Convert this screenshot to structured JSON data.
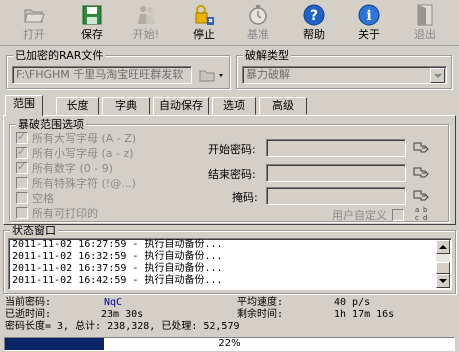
{
  "toolbar": {
    "buttons": [
      {
        "label": "打开",
        "icon": "open-folder-icon",
        "enabled": false
      },
      {
        "label": "保存",
        "icon": "save-disk-icon",
        "enabled": true
      },
      {
        "label": "开始!",
        "icon": "start-people-icon",
        "enabled": false
      },
      {
        "label": "停止",
        "icon": "stop-lock-icon",
        "enabled": true
      },
      {
        "label": "基准",
        "icon": "stopwatch-icon",
        "enabled": false
      },
      {
        "label": "帮助",
        "icon": "help-icon",
        "enabled": true
      },
      {
        "label": "关于",
        "icon": "info-icon",
        "enabled": true
      },
      {
        "label": "退出",
        "icon": "exit-door-icon",
        "enabled": false
      }
    ]
  },
  "file_group": {
    "title": "已加密的RAR文件",
    "path": "F:\\FHGHM 千里马淘宝旺旺群发软"
  },
  "crack_type": {
    "title": "破解类型",
    "selected": "暴力破解"
  },
  "tabs": [
    {
      "label": "范围",
      "active": true
    },
    {
      "label": "长度",
      "active": false
    },
    {
      "label": "字典",
      "active": false
    },
    {
      "label": "自动保存",
      "active": false
    },
    {
      "label": "选项",
      "active": false
    },
    {
      "label": "高级",
      "active": false
    }
  ],
  "range_options": {
    "title": "暴破范围选项",
    "checkboxes": [
      {
        "label": "所有大写字母 (A - Z)",
        "checked": true
      },
      {
        "label": "所有小写字母 (a - z)",
        "checked": true
      },
      {
        "label": "所有数字 (0 - 9)",
        "checked": true
      },
      {
        "label": "所有特殊字符 (!@...)",
        "checked": false
      },
      {
        "label": "空格",
        "checked": false
      },
      {
        "label": "所有可打印的",
        "checked": false
      }
    ],
    "start_password_label": "开始密码:",
    "end_password_label": "结束密码:",
    "mask_label": "掩码:",
    "user_defined_label": "用户自定义"
  },
  "status": {
    "title": "状态窗口",
    "log": [
      "2011-11-02 16:27:59 - 执行自动备份...",
      "2011-11-02 16:32:59 - 执行自动备份...",
      "2011-11-02 16:37:59 - 执行自动备份...",
      "2011-11-02 16:42:59 - 执行自动备份..."
    ]
  },
  "stats": {
    "current_password_label": "当前密码:",
    "current_password": "NqC",
    "elapsed_label": "已逝时间:",
    "elapsed": "23m 30s",
    "avg_speed_label": "平均速度:",
    "avg_speed": "40 p/s",
    "remaining_label": "剩余时间:",
    "remaining": "1h 17m 16s",
    "summary": "密码长度= 3, 总计: 238,328, 已处理: 52,579"
  },
  "progress": {
    "value_percent": 22,
    "label": "22%"
  },
  "colors": {
    "window_bg": "#d4d0c8",
    "progress_fill": "#0a246a",
    "highlight_text": "#0000a0"
  }
}
